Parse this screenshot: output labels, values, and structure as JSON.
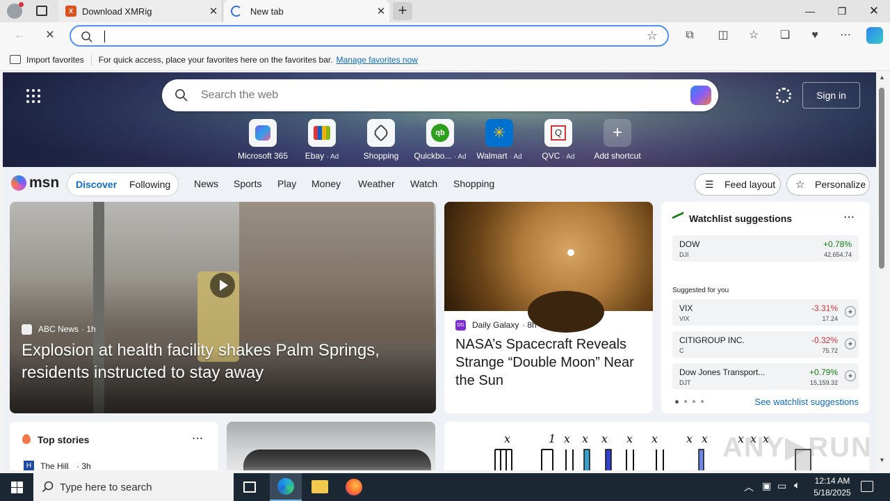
{
  "browser": {
    "tabs": [
      {
        "title": "Download XMRig",
        "favicon": "xmrig-favicon"
      },
      {
        "title": "New tab",
        "favicon": "edge-favicon"
      }
    ],
    "address": {
      "value": "",
      "placeholder": ""
    },
    "favorites_bar": {
      "import_label": "Import favorites",
      "hint": "For quick access, place your favorites here on the favorites bar.",
      "manage_link": "Manage favorites now"
    }
  },
  "newtab": {
    "search_placeholder": "Search the web",
    "sign_in": "Sign in",
    "shortcuts": [
      {
        "label": "Microsoft 365",
        "ad": ""
      },
      {
        "label": "Ebay",
        "ad": "· Ad"
      },
      {
        "label": "Shopping",
        "ad": ""
      },
      {
        "label": "Quickbo...",
        "ad": "· Ad"
      },
      {
        "label": "Walmart",
        "ad": "· Ad"
      },
      {
        "label": "QVC",
        "ad": "· Ad"
      },
      {
        "label": "Add shortcut",
        "ad": ""
      }
    ],
    "brand": "msn",
    "pills": [
      "Discover",
      "Following"
    ],
    "nav": [
      "News",
      "Sports",
      "Play",
      "Money",
      "Weather",
      "Watch",
      "Shopping"
    ],
    "feed_layout": "Feed layout",
    "personalize": "Personalize"
  },
  "lead_story": {
    "source": "ABC News",
    "age": "· 1h",
    "headline": "Explosion at health facility shakes Palm Springs, residents instructed to stay away"
  },
  "nasa_story": {
    "source": "Daily Galaxy",
    "age": "· 8h",
    "headline": "NASA’s Spacecraft Reveals Strange “Double Moon” Near the Sun"
  },
  "watchlist": {
    "title": "Watchlist suggestions",
    "primary": {
      "name": "DOW",
      "ticker": "DJI",
      "change": "+0.78%",
      "value": "42,654.74"
    },
    "suggested_label": "Suggested for you",
    "suggested": [
      {
        "name": "VIX",
        "ticker": "VIX",
        "change": "-3.31%",
        "value": "17.24"
      },
      {
        "name": "CITIGROUP INC.",
        "ticker": "C",
        "change": "-0.32%",
        "value": "75.72"
      },
      {
        "name": "Dow Jones Transport...",
        "ticker": "DJT",
        "change": "+0.79%",
        "value": "15,159.32"
      }
    ],
    "see_more": "See watchlist suggestions"
  },
  "top_stories": {
    "title": "Top stories",
    "first_source": "The Hill",
    "first_age": "· 3h"
  },
  "taskbar": {
    "search_placeholder": "Type here to search",
    "time": "12:14 AM",
    "date": "5/18/2025"
  },
  "colors": {
    "accent": "#0f6cbd",
    "positive": "#107c10",
    "negative": "#d13438"
  }
}
